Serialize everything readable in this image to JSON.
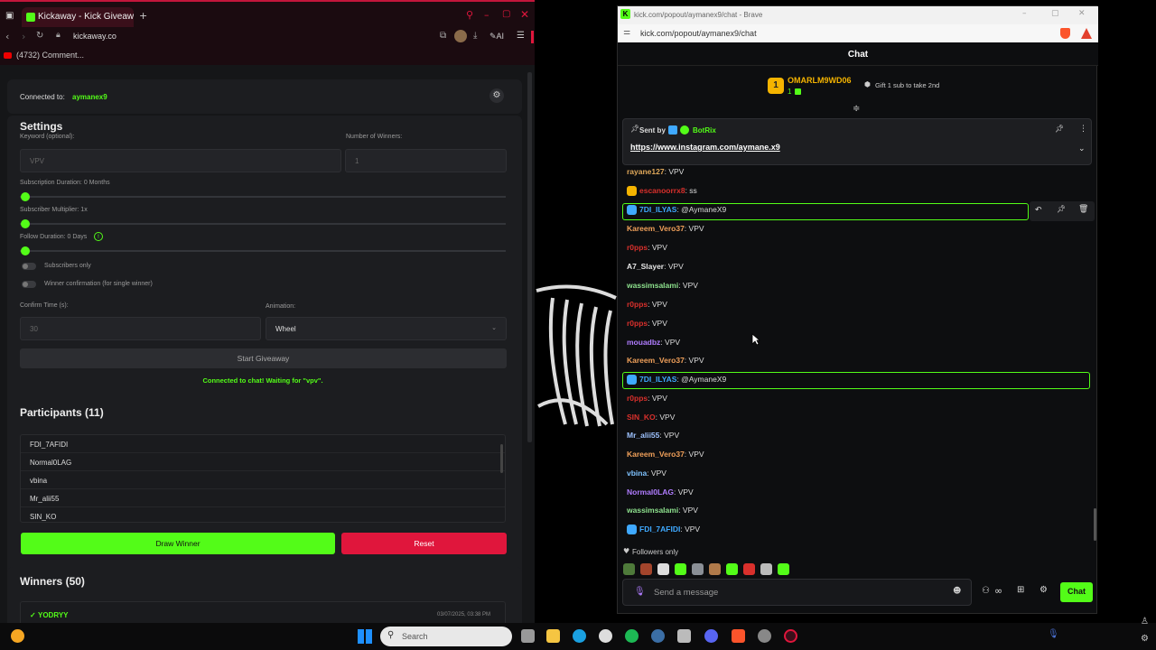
{
  "left_browser": {
    "tab_title": "Kickaway - Kick Giveaway",
    "address": "kickaway.co",
    "bookmark": "(4732) Comment...",
    "toolbar_ai": "AI"
  },
  "giveaway": {
    "connected_label": "Connected to:",
    "connected_channel": "aymanex9",
    "settings_title": "Settings",
    "keyword_label": "Keyword (optional):",
    "keyword_value": "VPV",
    "winners_label": "Number of Winners:",
    "winners_value": "1",
    "sub_duration": "Subscription Duration: 0 Months",
    "sub_multiplier": "Subscriber Multiplier: 1x",
    "follow_duration": "Follow Duration: 0 Days",
    "subscribers_only": "Subscribers only",
    "winner_confirmation": "Winner confirmation (for single winner)",
    "confirm_time_label": "Confirm Time (s):",
    "confirm_time_value": "30",
    "animation_label": "Animation:",
    "animation_value": "Wheel",
    "start_button": "Start Giveaway",
    "status_text": "Connected to chat! Waiting for \"vpv\".",
    "participants_title": "Participants (11)",
    "participants": [
      "FDI_7AFIDI",
      "Normal0LAG",
      "vbina",
      "Mr_alii55",
      "SIN_KO"
    ],
    "draw_button": "Draw Winner",
    "reset_button": "Reset",
    "winners_title": "Winners (50)",
    "winner_name": "YODRYY",
    "winner_check": "✓",
    "winner_time": "03/07/2025, 03:38 PM"
  },
  "right_browser": {
    "window_title": "kick.com/popout/aymanex9/chat - Brave",
    "address": "kick.com/popout/aymanex9/chat",
    "chat_header": "Chat",
    "top_gifter_rank": "1",
    "top_gifter_name": "OMARLM9WD06",
    "top_gifter_count": "1",
    "gift_cta": "Gift 1 sub to take 2nd",
    "pinned_sent_by": "Sent by",
    "pinned_author": "BotRix",
    "pinned_link": "https://www.instagram.com/aymane.x9",
    "followers_only": "Followers only",
    "send_placeholder": "Send a message",
    "chat_button": "Chat"
  },
  "messages": [
    {
      "user": "rayane127",
      "color": "#e0a85a",
      "text": ": VPV"
    },
    {
      "user": "escanoorrx8",
      "color": "#d9302c",
      "text": ": ss"
    },
    {
      "user": "7DI_ILYAS",
      "color": "#3fa9ff",
      "text": ": @AymaneX9"
    },
    {
      "user": "Kareem_Vero37",
      "color": "#f0a05a",
      "text": ": VPV"
    },
    {
      "user": "r0pps",
      "color": "#d9302c",
      "text": ": VPV"
    },
    {
      "user": "A7_Slayer",
      "color": "#e6e6e6",
      "text": ": VPV"
    },
    {
      "user": "wassimsalami",
      "color": "#8ee28e",
      "text": ": VPV"
    },
    {
      "user": "r0pps",
      "color": "#d9302c",
      "text": ": VPV"
    },
    {
      "user": "r0pps",
      "color": "#d9302c",
      "text": ": VPV"
    },
    {
      "user": "mouadbz",
      "color": "#b07cff",
      "text": ": VPV"
    },
    {
      "user": "Kareem_Vero37",
      "color": "#f0a05a",
      "text": ": VPV"
    },
    {
      "user": "7DI_ILYAS",
      "color": "#3fa9ff",
      "text": ": @AymaneX9"
    },
    {
      "user": "r0pps",
      "color": "#d9302c",
      "text": ": VPV"
    },
    {
      "user": "SIN_KO",
      "color": "#d9302c",
      "text": ": VPV"
    },
    {
      "user": "Mr_alii55",
      "color": "#9ec3ff",
      "text": ": VPV"
    },
    {
      "user": "Kareem_Vero37",
      "color": "#f0a05a",
      "text": ": VPV"
    },
    {
      "user": "vbina",
      "color": "#7fc3ff",
      "text": ": VPV"
    },
    {
      "user": "Normal0LAG",
      "color": "#b07cff",
      "text": ": VPV"
    },
    {
      "user": "wassimsalami",
      "color": "#8ee28e",
      "text": ": VPV"
    },
    {
      "user": "FDI_7AFIDI",
      "color": "#3fa9ff",
      "text": ": VPV"
    }
  ],
  "taskbar": {
    "search_placeholder": "Search"
  },
  "colors": {
    "kick_green": "#53fc18",
    "reset_red": "#e0163c"
  }
}
